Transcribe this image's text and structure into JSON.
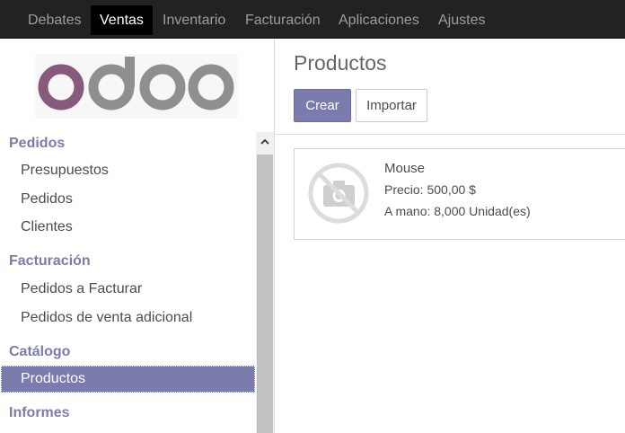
{
  "topmenu": {
    "items": [
      {
        "label": "Debates",
        "active": false
      },
      {
        "label": "Ventas",
        "active": true
      },
      {
        "label": "Inventario",
        "active": false
      },
      {
        "label": "Facturación",
        "active": false
      },
      {
        "label": "Aplicaciones",
        "active": false
      },
      {
        "label": "Ajustes",
        "active": false
      }
    ]
  },
  "logo": {
    "text": "odoo",
    "color": "#875a7b",
    "secondary_color": "#8f8f8f"
  },
  "sidebar": {
    "sections": [
      {
        "title": "Pedidos",
        "items": [
          "Presupuestos",
          "Pedidos",
          "Clientes"
        ]
      },
      {
        "title": "Facturación",
        "items": [
          "Pedidos a Facturar",
          "Pedidos de venta adicional"
        ]
      },
      {
        "title": "Catálogo",
        "items": [
          "Productos"
        ]
      },
      {
        "title": "Informes",
        "items": []
      }
    ],
    "active_item": "Productos"
  },
  "main": {
    "title": "Productos",
    "buttons": {
      "create": "Crear",
      "import": "Importar"
    },
    "products": [
      {
        "name": "Mouse",
        "price": "Precio: 500,00 $",
        "stock": "A mano: 8,000 Unidad(es)",
        "image": "no-image-camera-icon"
      }
    ]
  },
  "colors": {
    "accent": "#7c7bad",
    "topbar": "#222222",
    "active_top": "#000000"
  }
}
